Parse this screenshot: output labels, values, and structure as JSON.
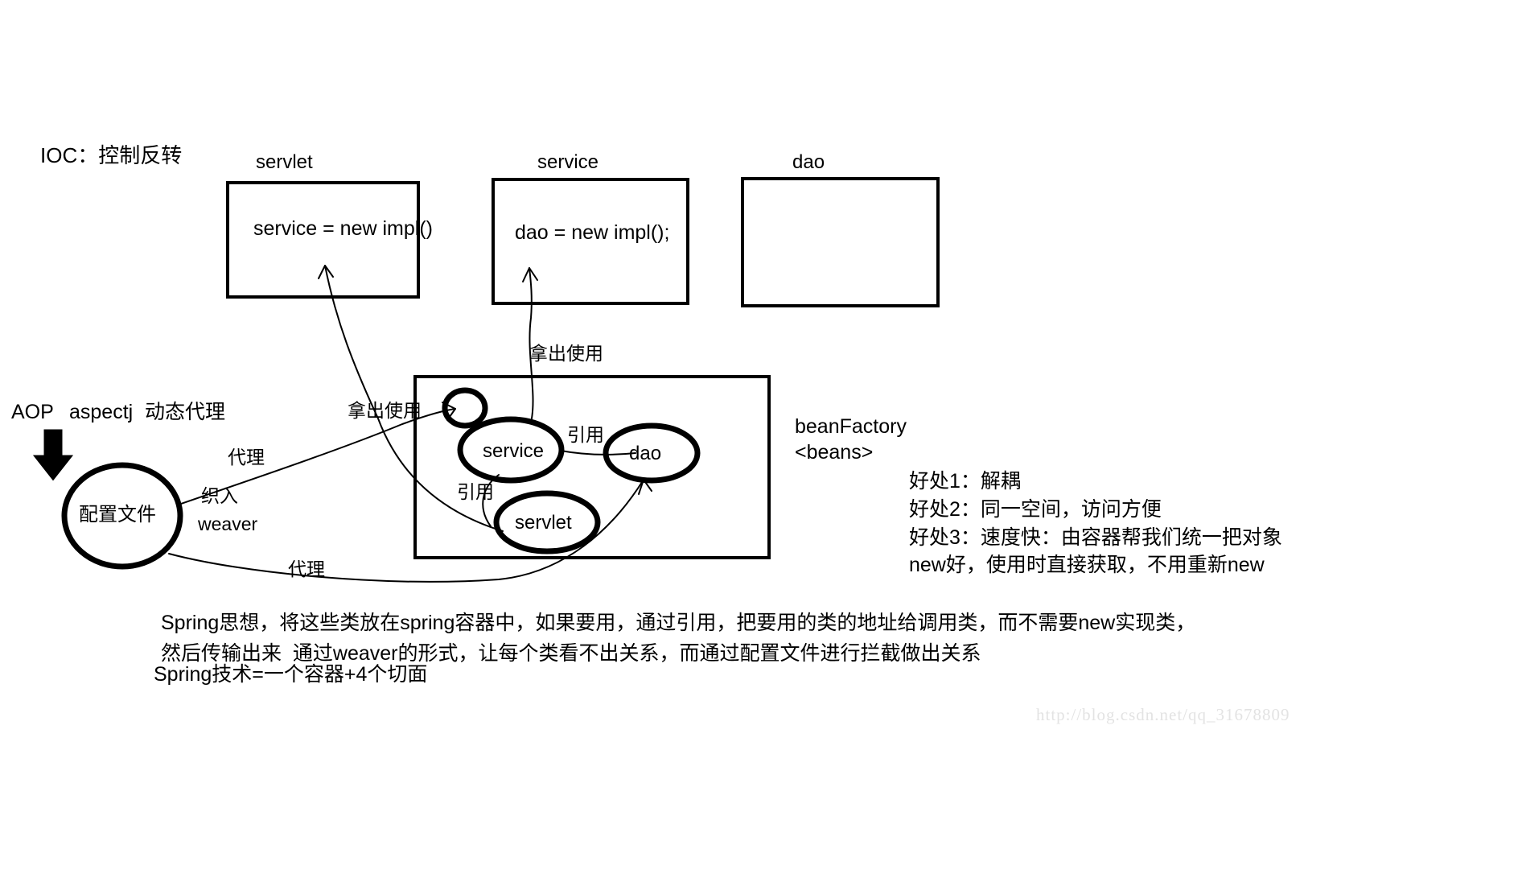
{
  "diagram": {
    "title": "IOC：控制反转",
    "watermark": "http://blog.csdn.net/qq_31678809",
    "class_boxes": [
      {
        "name": "servlet",
        "body": "service = new impl()"
      },
      {
        "name": "service",
        "body": "dao = new impl();"
      },
      {
        "name": "dao",
        "body": ""
      }
    ],
    "container": {
      "name_line1": "beanFactory",
      "name_line2": "<beans>",
      "nodes": [
        {
          "label": ""
        },
        {
          "label": "service"
        },
        {
          "label": "dao"
        },
        {
          "label": "servlet"
        }
      ]
    },
    "edge_labels": {
      "take_out_use_left": "拿出使用",
      "take_out_use_mid": "拿出使用",
      "reference_service_dao": "引用",
      "reference_servlet_service": "引用",
      "proxy_top": "代理",
      "proxy_bottom": "代理",
      "weave_cn": "织入",
      "weave_en": "weaver"
    },
    "aop": {
      "name": "AOP",
      "framework": "aspectj",
      "mechanism": "动态代理",
      "config_node": "配置文件"
    },
    "benefits": [
      "好处1：解耦",
      "好处2：同一空间，访问方便",
      "好处3：速度快：由容器帮我们统一把对象",
      "new好，使用时直接获取，不用重新new"
    ],
    "summary": [
      "Spring思想，将这些类放在spring容器中，如果要用，通过引用，把要用的类的地址给调用类，而不需要new实现类，",
      "然后传输出来  通过weaver的形式，让每个类看不出关系，而通过配置文件进行拦截做出关系",
      "Spring技术=一个容器+4个切面"
    ]
  }
}
